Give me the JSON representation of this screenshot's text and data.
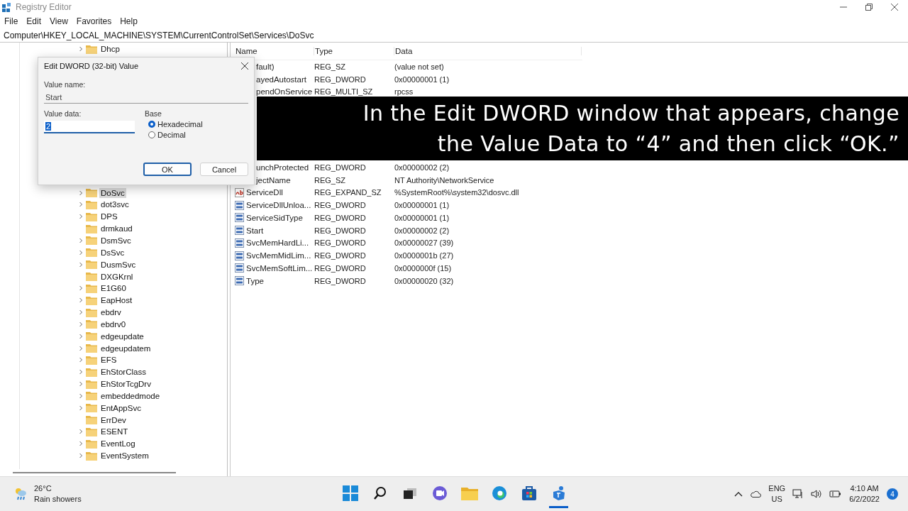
{
  "window": {
    "title": "Registry Editor"
  },
  "menu": [
    "File",
    "Edit",
    "View",
    "Favorites",
    "Help"
  ],
  "address": "Computer\\HKEY_LOCAL_MACHINE\\SYSTEM\\CurrentControlSet\\Services\\DoSvc",
  "tree": {
    "items_above": [
      {
        "label": "Dhcp",
        "expandable": true,
        "selected": false
      }
    ],
    "items": [
      {
        "label": "DoSvc",
        "expandable": true,
        "selected": true
      },
      {
        "label": "dot3svc",
        "expandable": true,
        "selected": false
      },
      {
        "label": "DPS",
        "expandable": true,
        "selected": false
      },
      {
        "label": "drmkaud",
        "expandable": false,
        "selected": false
      },
      {
        "label": "DsmSvc",
        "expandable": true,
        "selected": false
      },
      {
        "label": "DsSvc",
        "expandable": true,
        "selected": false
      },
      {
        "label": "DusmSvc",
        "expandable": true,
        "selected": false
      },
      {
        "label": "DXGKrnl",
        "expandable": false,
        "selected": false
      },
      {
        "label": "E1G60",
        "expandable": true,
        "selected": false
      },
      {
        "label": "EapHost",
        "expandable": true,
        "selected": false
      },
      {
        "label": "ebdrv",
        "expandable": true,
        "selected": false
      },
      {
        "label": "ebdrv0",
        "expandable": true,
        "selected": false
      },
      {
        "label": "edgeupdate",
        "expandable": true,
        "selected": false
      },
      {
        "label": "edgeupdatem",
        "expandable": true,
        "selected": false
      },
      {
        "label": "EFS",
        "expandable": true,
        "selected": false
      },
      {
        "label": "EhStorClass",
        "expandable": true,
        "selected": false
      },
      {
        "label": "EhStorTcgDrv",
        "expandable": true,
        "selected": false
      },
      {
        "label": "embeddedmode",
        "expandable": true,
        "selected": false
      },
      {
        "label": "EntAppSvc",
        "expandable": true,
        "selected": false
      },
      {
        "label": "ErrDev",
        "expandable": false,
        "selected": false
      },
      {
        "label": "ESENT",
        "expandable": true,
        "selected": false
      },
      {
        "label": "EventLog",
        "expandable": true,
        "selected": false
      },
      {
        "label": "EventSystem",
        "expandable": true,
        "selected": false
      }
    ]
  },
  "values": {
    "columns": [
      "Name",
      "Type",
      "Data"
    ],
    "rows_above": [
      {
        "kind": "partial",
        "name": "fault)",
        "type": "REG_SZ",
        "data": "(value not set)"
      },
      {
        "kind": "partial",
        "name": "ayedAutostart",
        "type": "REG_DWORD",
        "data": "0x00000001 (1)"
      },
      {
        "kind": "partial",
        "name": "pendOnService",
        "type": "REG_MULTI_SZ",
        "data": "rpcss"
      }
    ],
    "rows": [
      {
        "kind": "partial",
        "name": "unchProtected",
        "type": "REG_DWORD",
        "data": "0x00000002 (2)"
      },
      {
        "kind": "partial",
        "name": "jectName",
        "type": "REG_SZ",
        "data": "NT Authority\\NetworkService"
      },
      {
        "kind": "string",
        "name": "ServiceDll",
        "type": "REG_EXPAND_SZ",
        "data": "%SystemRoot%\\system32\\dosvc.dll"
      },
      {
        "kind": "dword",
        "name": "ServiceDllUnloa...",
        "type": "REG_DWORD",
        "data": "0x00000001 (1)"
      },
      {
        "kind": "dword",
        "name": "ServiceSidType",
        "type": "REG_DWORD",
        "data": "0x00000001 (1)"
      },
      {
        "kind": "dword",
        "name": "Start",
        "type": "REG_DWORD",
        "data": "0x00000002 (2)"
      },
      {
        "kind": "dword",
        "name": "SvcMemHardLi...",
        "type": "REG_DWORD",
        "data": "0x00000027 (39)"
      },
      {
        "kind": "dword",
        "name": "SvcMemMidLim...",
        "type": "REG_DWORD",
        "data": "0x0000001b (27)"
      },
      {
        "kind": "dword",
        "name": "SvcMemSoftLim...",
        "type": "REG_DWORD",
        "data": "0x0000000f (15)"
      },
      {
        "kind": "dword",
        "name": "Type",
        "type": "REG_DWORD",
        "data": "0x00000020 (32)"
      }
    ]
  },
  "dialog": {
    "title": "Edit DWORD (32-bit) Value",
    "value_name_label": "Value name:",
    "value_name": "Start",
    "value_data_label": "Value data:",
    "value_data": "2",
    "base_label": "Base",
    "bases": [
      {
        "label": "Hexadecimal",
        "selected": true
      },
      {
        "label": "Decimal",
        "selected": false
      }
    ],
    "buttons": [
      "OK",
      "Cancel"
    ]
  },
  "caption": [
    "In the Edit DWORD window that appears, change",
    "the Value Data to “4” and then click “OK.”"
  ],
  "taskbar": {
    "temperature": "26°C",
    "weather": "Rain showers",
    "language": "ENG",
    "region": "US",
    "time": "4:10 AM",
    "date": "6/2/2022",
    "notifications": "4"
  }
}
